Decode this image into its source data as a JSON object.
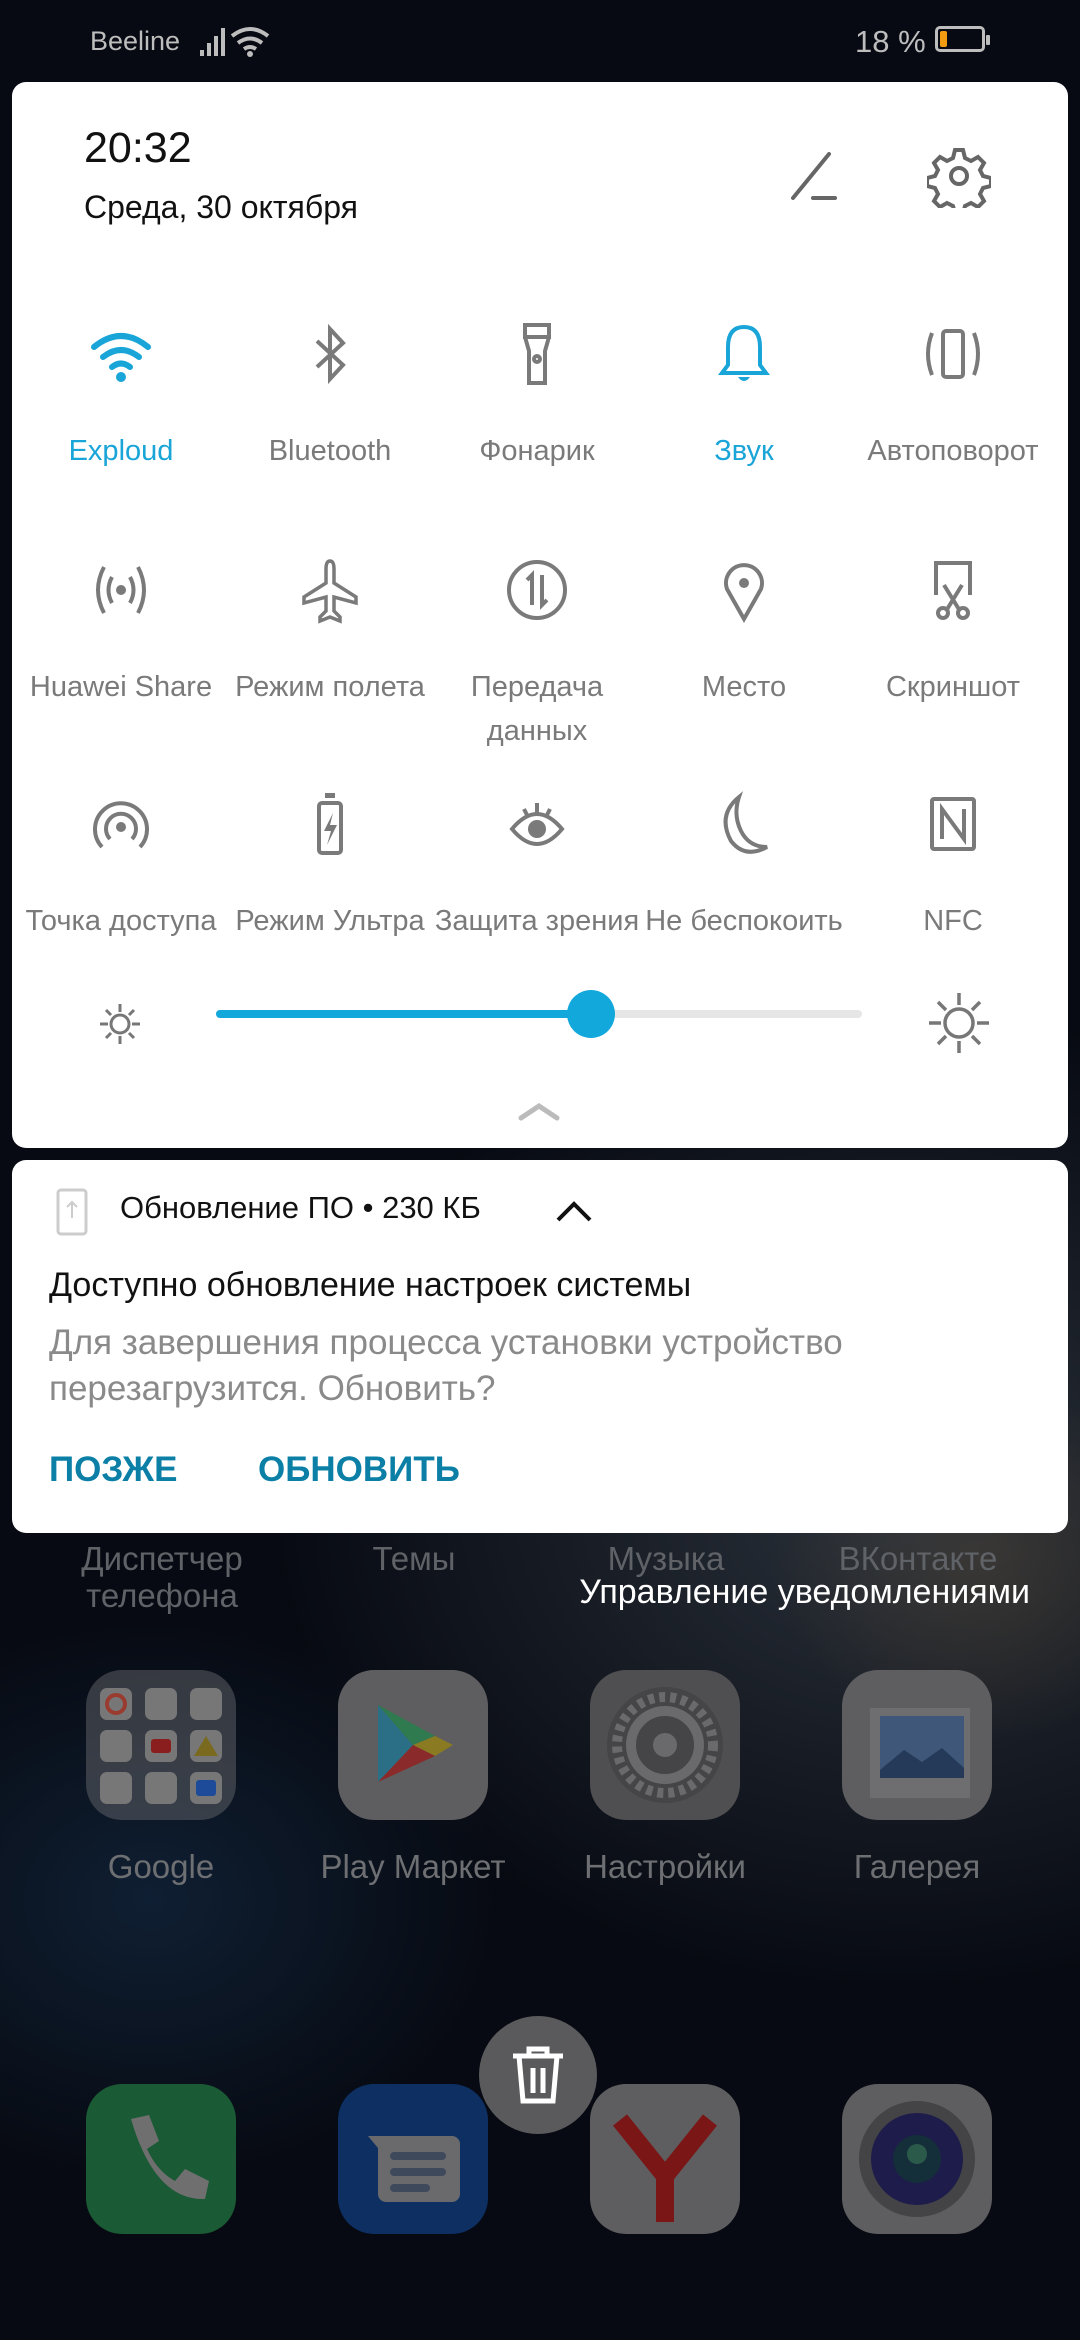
{
  "status_bar": {
    "carrier": "Beeline",
    "battery_text": "18 %",
    "battery_level": 18,
    "battery_color": "#f39c12"
  },
  "header": {
    "time": "20:32",
    "date": "Среда, 30 октября",
    "edit_icon": "pencil-icon",
    "settings_icon": "gear-icon"
  },
  "accent_color": "#1aa5d8",
  "tiles": [
    {
      "label": "Exploud",
      "icon": "wifi-icon",
      "active": true
    },
    {
      "label": "Bluetooth",
      "icon": "bluetooth-icon",
      "active": false
    },
    {
      "label": "Фонарик",
      "icon": "flashlight-icon",
      "active": false
    },
    {
      "label": "Звук",
      "icon": "bell-icon",
      "active": true
    },
    {
      "label": "Автоповорот",
      "icon": "auto-rotate-icon",
      "active": false
    },
    {
      "label": "Huawei Share",
      "icon": "huawei-share-icon",
      "active": false
    },
    {
      "label": "Режим полета",
      "icon": "airplane-icon",
      "active": false
    },
    {
      "label": "Передача данных",
      "icon": "mobile-data-icon",
      "active": false
    },
    {
      "label": "Место",
      "icon": "location-icon",
      "active": false
    },
    {
      "label": "Скриншот",
      "icon": "screenshot-icon",
      "active": false
    },
    {
      "label": "Точка доступа",
      "icon": "hotspot-icon",
      "active": false
    },
    {
      "label": "Режим Ультра",
      "icon": "battery-saver-icon",
      "active": false
    },
    {
      "label": "Защита зрения",
      "icon": "eye-icon",
      "active": false
    },
    {
      "label": "Не беспокоить",
      "icon": "moon-icon",
      "active": false
    },
    {
      "label": "NFC",
      "icon": "nfc-icon",
      "active": false
    }
  ],
  "brightness": {
    "percent": 58
  },
  "notification": {
    "app": "Обновление ПО • 230 КБ",
    "title": "Доступно обновление настроек системы",
    "body": "Для завершения процесса установки устройство перезагрузится. Обновить?",
    "buttons": [
      "ПОЗЖЕ",
      "ОБНОВИТЬ"
    ]
  },
  "manage_notifications": "Управление уведомлениями",
  "home": {
    "top_labels": [
      "Диспетчер телефона",
      "Темы",
      "Музыка",
      "ВКонтакте"
    ],
    "apps": [
      "Google",
      "Play Маркет",
      "Настройки",
      "Галерея"
    ],
    "dock": [
      "phone-icon",
      "messages-icon",
      "yandex-icon",
      "camera-icon"
    ]
  }
}
